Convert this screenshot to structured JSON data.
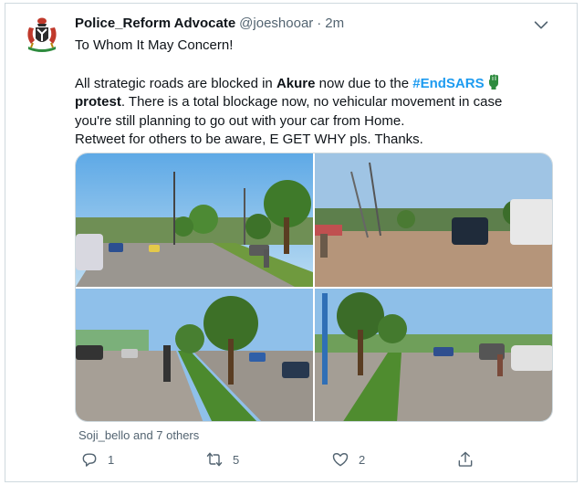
{
  "tweet": {
    "display_name": "Police_Reform Advocate",
    "handle": "@joeshooar",
    "separator": "·",
    "time": "2m",
    "text": {
      "line1": "To Whom It May Concern!",
      "p2_part1": "All strategic roads are blocked in ",
      "p2_place": "Akure",
      "p2_part2": " now due to the ",
      "p2_hashtag": "#EndSARS",
      "p2_bold_word": "protest",
      "p2_part3": ". There is a total blockage now, no vehicular movement in case you're still planning to go out with your car from Home.",
      "p3": "Retweet for others to be aware, E GET WHY pls. Thanks."
    },
    "media": {
      "count": 4,
      "photos": [
        "road-scene-1",
        "road-scene-2",
        "road-scene-3",
        "road-scene-4"
      ]
    },
    "liked_by": "Soji_bello and 7 others",
    "actions": {
      "reply": {
        "icon": "reply-icon",
        "count": "1"
      },
      "retweet": {
        "icon": "retweet-icon",
        "count": "5"
      },
      "like": {
        "icon": "heart-icon",
        "count": "2"
      },
      "share": {
        "icon": "share-icon",
        "count": ""
      }
    },
    "avatar_icon": "coat-of-arms-icon",
    "menu_icon": "chevron-down-icon"
  },
  "colors": {
    "text": "#0f1419",
    "muted": "#536471",
    "link": "#1d9bf0",
    "border": "#cfd9de",
    "fist_green": "#2e8b3e"
  }
}
